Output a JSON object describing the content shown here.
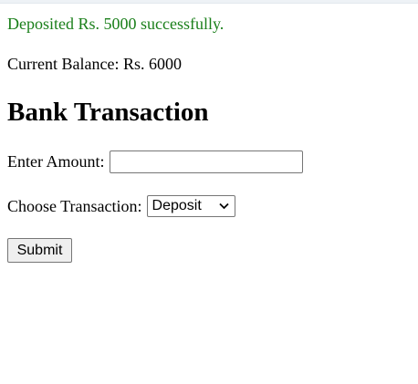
{
  "status": {
    "message": "Deposited Rs. 5000 successfully.",
    "color": "#1a7f1a"
  },
  "balance": {
    "text": "Current Balance: Rs. 6000"
  },
  "page": {
    "title": "Bank Transaction"
  },
  "form": {
    "amount_label": "Enter Amount:",
    "amount_value": "",
    "transaction_label": "Choose Transaction:",
    "transaction_selected": "Deposit",
    "submit_label": "Submit"
  },
  "icons": {
    "select_arrow": "chevron-down-icon"
  }
}
